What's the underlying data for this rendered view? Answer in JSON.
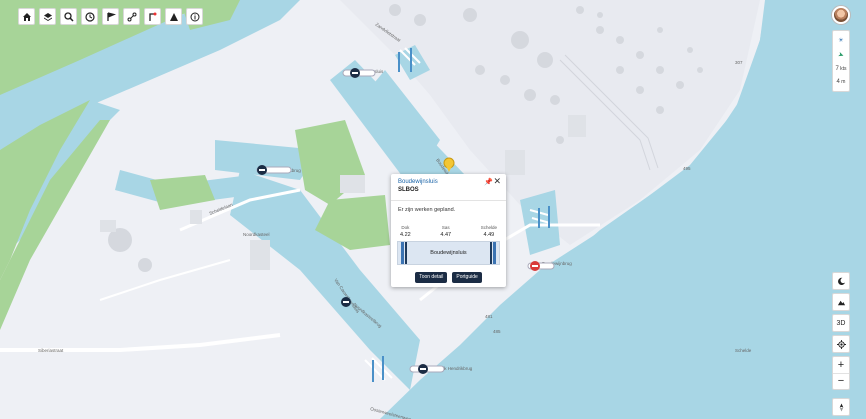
{
  "toolbar": {
    "buttons": [
      {
        "name": "home-icon"
      },
      {
        "name": "layers-icon"
      },
      {
        "name": "search-icon"
      },
      {
        "name": "clock-icon"
      },
      {
        "name": "flag-icon"
      },
      {
        "name": "route-icon"
      },
      {
        "name": "ruler-icon"
      },
      {
        "name": "triangle-icon"
      },
      {
        "name": "info-icon"
      }
    ]
  },
  "weather": {
    "wind_speed": "7",
    "wind_unit": "kts",
    "temperature": "4",
    "temperature_unit": "m"
  },
  "right_controls": {
    "view_3d": "3D",
    "zoom_in": "+",
    "zoom_out": "−"
  },
  "popup": {
    "title": "Boudewijnsluis",
    "code": "SLBOS",
    "notice": "Er zijn werken gepland.",
    "stats": [
      {
        "label": "Dok",
        "value": "4.22"
      },
      {
        "label": "Sas",
        "value": "4.47"
      },
      {
        "label": "Schelde",
        "value": "4.49"
      }
    ],
    "lock_name": "Boudewijnsluis",
    "button_detail": "Toon detail",
    "button_portguide": "Portguide"
  },
  "map_labels": {
    "l1": "Siberiastraat",
    "l2": "Royerssluis",
    "l3": "Boudewijnsluis",
    "l4": "Kattendijkbrug",
    "l5": "Schelde",
    "l6": "Noordkasteel",
    "l7": "Oosterweelsteenweg",
    "l8": "Boudewijnbrug",
    "l9": "Van Cauwelaertsluis",
    "l10": "Scheldelaan",
    "l11": "Noordkasteelbrug",
    "l12": "Frederik Hendrikbrug",
    "l13": "Zandvlietstraat",
    "n1": "307",
    "n2": "495",
    "n3": "485",
    "n4": "481"
  },
  "colors": {
    "water": "#a8d6e5",
    "land": "#eef0f5",
    "green": "#a7d498",
    "road": "#ffffff",
    "accent": "#1b2c44"
  }
}
